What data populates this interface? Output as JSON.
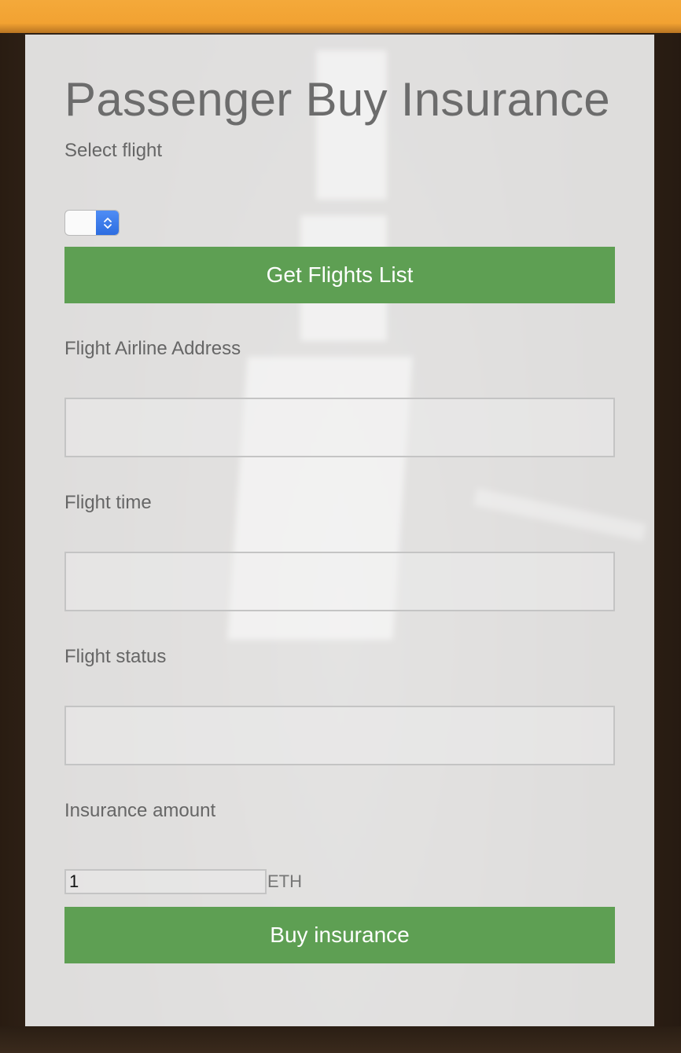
{
  "page": {
    "title": "Passenger Buy Insurance"
  },
  "flight_select": {
    "label": "Select flight",
    "selected": ""
  },
  "buttons": {
    "get_flights": "Get Flights List",
    "buy_insurance": "Buy insurance"
  },
  "fields": {
    "airline_address_label": "Flight Airline Address",
    "airline_address_value": "",
    "time_label": "Flight time",
    "time_value": "",
    "status_label": "Flight status",
    "status_value": ""
  },
  "insurance": {
    "label": "Insurance amount",
    "amount": "1",
    "unit": "ETH"
  },
  "colors": {
    "accent_green": "#5e9f53",
    "header_orange": "#f2a232",
    "select_blue": "#2d6de0"
  },
  "icons": {
    "select_arrow": "chevron-up-down-icon"
  }
}
